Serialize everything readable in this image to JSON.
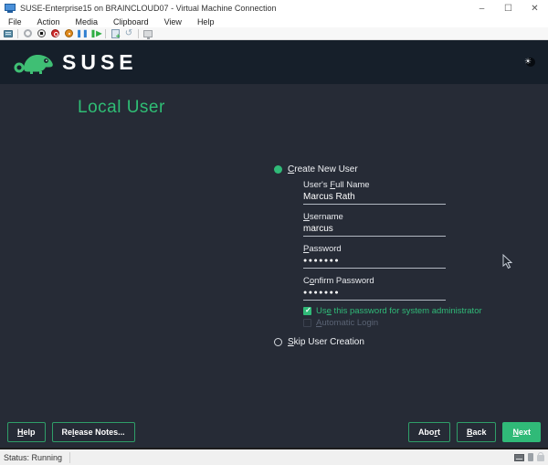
{
  "window": {
    "title": "SUSE-Enterprise15 on BRAINCLOUD07 - Virtual Machine Connection",
    "controls": {
      "minimize": "–",
      "maximize": "☐",
      "close": "✕"
    }
  },
  "menu": {
    "items": [
      "File",
      "Action",
      "Media",
      "Clipboard",
      "View",
      "Help"
    ]
  },
  "toolbar": {
    "icons": [
      "ctrl-alt-del-icon",
      "start-icon",
      "turn-off-icon",
      "shut-down-icon",
      "save-icon",
      "pause-icon",
      "resume-icon",
      "checkpoint-icon",
      "revert-icon",
      "enhanced-session-icon"
    ],
    "pause_glyph": "❚❚",
    "resume_glyph": "❚▶",
    "revert_glyph": "↺"
  },
  "installer": {
    "brand": "SUSE",
    "heading": "Local User",
    "form": {
      "create_radio": "&Create New User",
      "fields": [
        {
          "label": "User's &Full Name",
          "value": "Marcus Rath"
        },
        {
          "label": "&Username",
          "value": "marcus"
        },
        {
          "label": "&Password",
          "value": "●●●●●●●"
        },
        {
          "label": "C&onfirm Password",
          "value": "●●●●●●●"
        }
      ],
      "checkboxes": [
        {
          "label": "Us&e this password for system administrator",
          "checked": true
        },
        {
          "label": "&Automatic Login",
          "checked": false
        }
      ],
      "skip_radio": "&Skip User Creation"
    },
    "buttons": {
      "help": "&Help",
      "release_notes": "Re&lease Notes...",
      "abort": "Abo&rt",
      "back": "&Back",
      "next": "&Next"
    },
    "colors": {
      "accent_green": "#30ba78",
      "header_bg": "#161f2a",
      "content_bg": "#262b36"
    }
  },
  "status_bar": {
    "text": "Status: Running"
  }
}
